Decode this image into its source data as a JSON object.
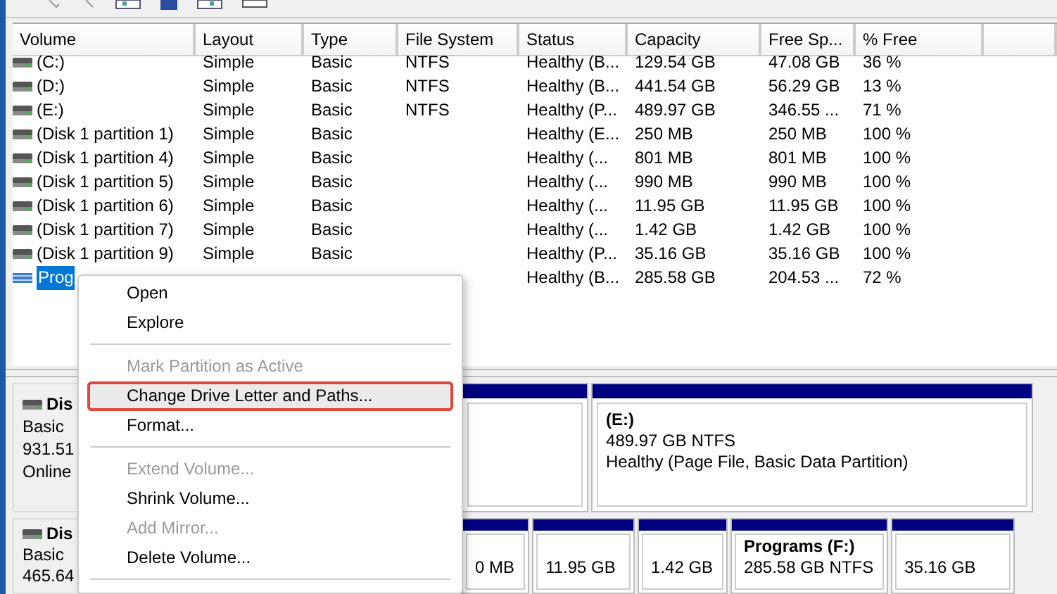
{
  "columns": [
    "Volume",
    "Layout",
    "Type",
    "File System",
    "Status",
    "Capacity",
    "Free Sp...",
    "% Free"
  ],
  "rows": [
    {
      "volume": "(C:)",
      "layout": "Simple",
      "type": "Basic",
      "file_system": "NTFS",
      "status": "Healthy (B...",
      "capacity": "129.54 GB",
      "free_space": "47.08 GB",
      "percent_free": "36 %",
      "selected": false
    },
    {
      "volume": "(D:)",
      "layout": "Simple",
      "type": "Basic",
      "file_system": "NTFS",
      "status": "Healthy (B...",
      "capacity": "441.54 GB",
      "free_space": "56.29 GB",
      "percent_free": "13 %",
      "selected": false
    },
    {
      "volume": "(E:)",
      "layout": "Simple",
      "type": "Basic",
      "file_system": "NTFS",
      "status": "Healthy (P...",
      "capacity": "489.97 GB",
      "free_space": "346.55 ...",
      "percent_free": "71 %",
      "selected": false
    },
    {
      "volume": "(Disk 1 partition 1)",
      "layout": "Simple",
      "type": "Basic",
      "status": "Healthy (E...",
      "capacity": "250 MB",
      "free_space": "250 MB",
      "percent_free": "100 %",
      "selected": false
    },
    {
      "volume": "(Disk 1 partition 4)",
      "layout": "Simple",
      "type": "Basic",
      "status": "Healthy (...",
      "capacity": "801 MB",
      "free_space": "801 MB",
      "percent_free": "100 %",
      "selected": false
    },
    {
      "volume": "(Disk 1 partition 5)",
      "layout": "Simple",
      "type": "Basic",
      "status": "Healthy (...",
      "capacity": "990 MB",
      "free_space": "990 MB",
      "percent_free": "100 %",
      "selected": false
    },
    {
      "volume": "(Disk 1 partition 6)",
      "layout": "Simple",
      "type": "Basic",
      "status": "Healthy (...",
      "capacity": "11.95 GB",
      "free_space": "11.95 GB",
      "percent_free": "100 %",
      "selected": false
    },
    {
      "volume": "(Disk 1 partition 7)",
      "layout": "Simple",
      "type": "Basic",
      "status": "Healthy (...",
      "capacity": "1.42 GB",
      "free_space": "1.42 GB",
      "percent_free": "100 %",
      "selected": false
    },
    {
      "volume": "(Disk 1 partition 9)",
      "layout": "Simple",
      "type": "Basic",
      "status": "Healthy (P...",
      "capacity": "35.16 GB",
      "free_space": "35.16 GB",
      "percent_free": "100 %",
      "selected": false
    },
    {
      "volume": "Prog",
      "status": "Healthy (B...",
      "capacity": "285.58 GB",
      "free_space": "204.53 ...",
      "percent_free": "72 %",
      "selected": true
    }
  ],
  "disks": [
    {
      "name": "Dis",
      "type": "Basic",
      "size": "931.51",
      "state": "Online",
      "partitions": [
        {
          "kind": "hidden"
        },
        {
          "kind": "volume"
        },
        {
          "kind": "volume",
          "name": "(E:)",
          "size": "489.97 GB NTFS",
          "status": "Healthy (Page File, Basic Data Partition)"
        }
      ]
    },
    {
      "name": "Dis",
      "type": "Basic",
      "size": "465.64",
      "partitions": [
        {
          "kind": "hidden"
        },
        {
          "kind": "volume",
          "size": "0 MB"
        },
        {
          "kind": "volume",
          "size": "11.95 GB"
        },
        {
          "kind": "volume",
          "size": "1.42 GB"
        },
        {
          "kind": "volume",
          "name": "Programs  (F:)",
          "size": "285.58 GB NTFS"
        },
        {
          "kind": "volume",
          "size": "35.16 GB"
        }
      ]
    }
  ],
  "context_menu": [
    {
      "kind": "item",
      "label": "Open",
      "disabled": false,
      "selected": false
    },
    {
      "kind": "item",
      "label": "Explore",
      "disabled": false,
      "selected": false
    },
    {
      "kind": "separator"
    },
    {
      "kind": "item",
      "label": "Mark Partition as Active",
      "disabled": true,
      "selected": false
    },
    {
      "kind": "item",
      "label": "Change Drive Letter and Paths...",
      "disabled": false,
      "selected": true
    },
    {
      "kind": "item",
      "label": "Format...",
      "disabled": false,
      "selected": false
    },
    {
      "kind": "separator"
    },
    {
      "kind": "item",
      "label": "Extend Volume...",
      "disabled": true,
      "selected": false
    },
    {
      "kind": "item",
      "label": "Shrink Volume...",
      "disabled": false,
      "selected": false
    },
    {
      "kind": "item",
      "label": "Add Mirror...",
      "disabled": true,
      "selected": false
    },
    {
      "kind": "item",
      "label": "Delete Volume...",
      "disabled": false,
      "selected": false
    },
    {
      "kind": "separator"
    }
  ]
}
